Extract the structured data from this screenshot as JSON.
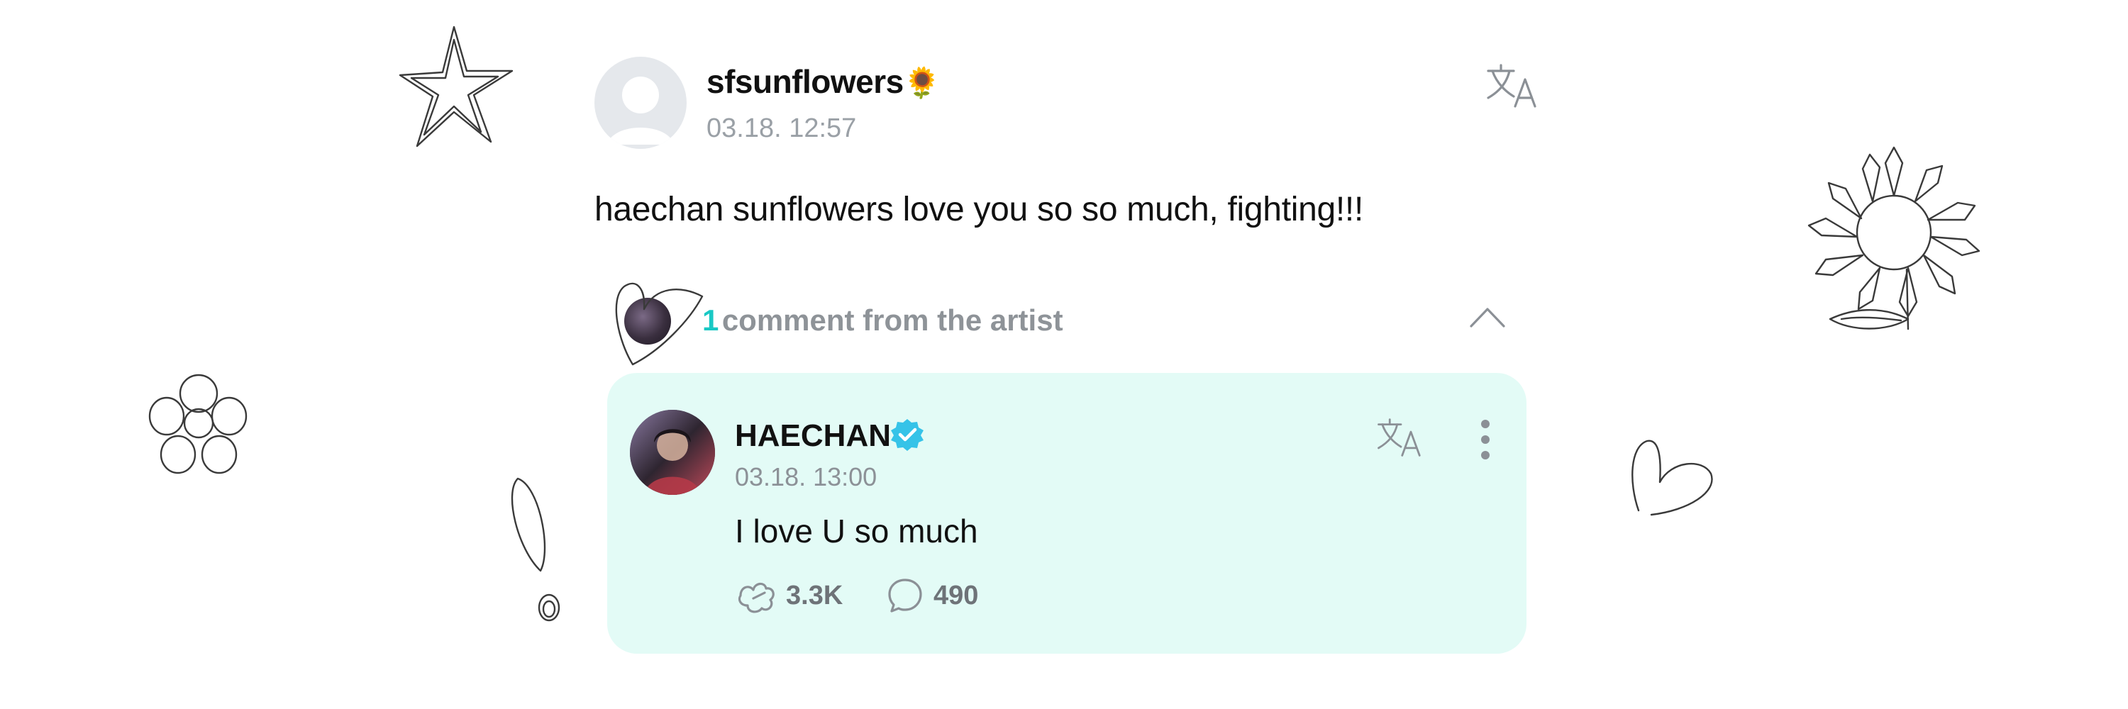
{
  "post": {
    "username": "sfsunflowers",
    "username_emoji": "🌻",
    "timestamp": "03.18. 12:57",
    "text": "haechan sunflowers love you so so much, fighting!!!",
    "translate_icon": "translate-icon"
  },
  "comments_section": {
    "count": "1",
    "label": "comment from the artist",
    "collapse_icon": "chevron-up-icon"
  },
  "artist_comment": {
    "name": "HAECHAN",
    "verified_icon": "verified-badge-icon",
    "timestamp": "03.18. 13:00",
    "text": "I love U so much",
    "likes": "3.3K",
    "replies": "490",
    "like_icon": "like-icon",
    "reply_icon": "reply-icon",
    "more_icon": "more-vertical-icon"
  },
  "colors": {
    "accent": "#19c8c4",
    "card_background": "#e3fbf6",
    "verified": "#36c3e8"
  }
}
